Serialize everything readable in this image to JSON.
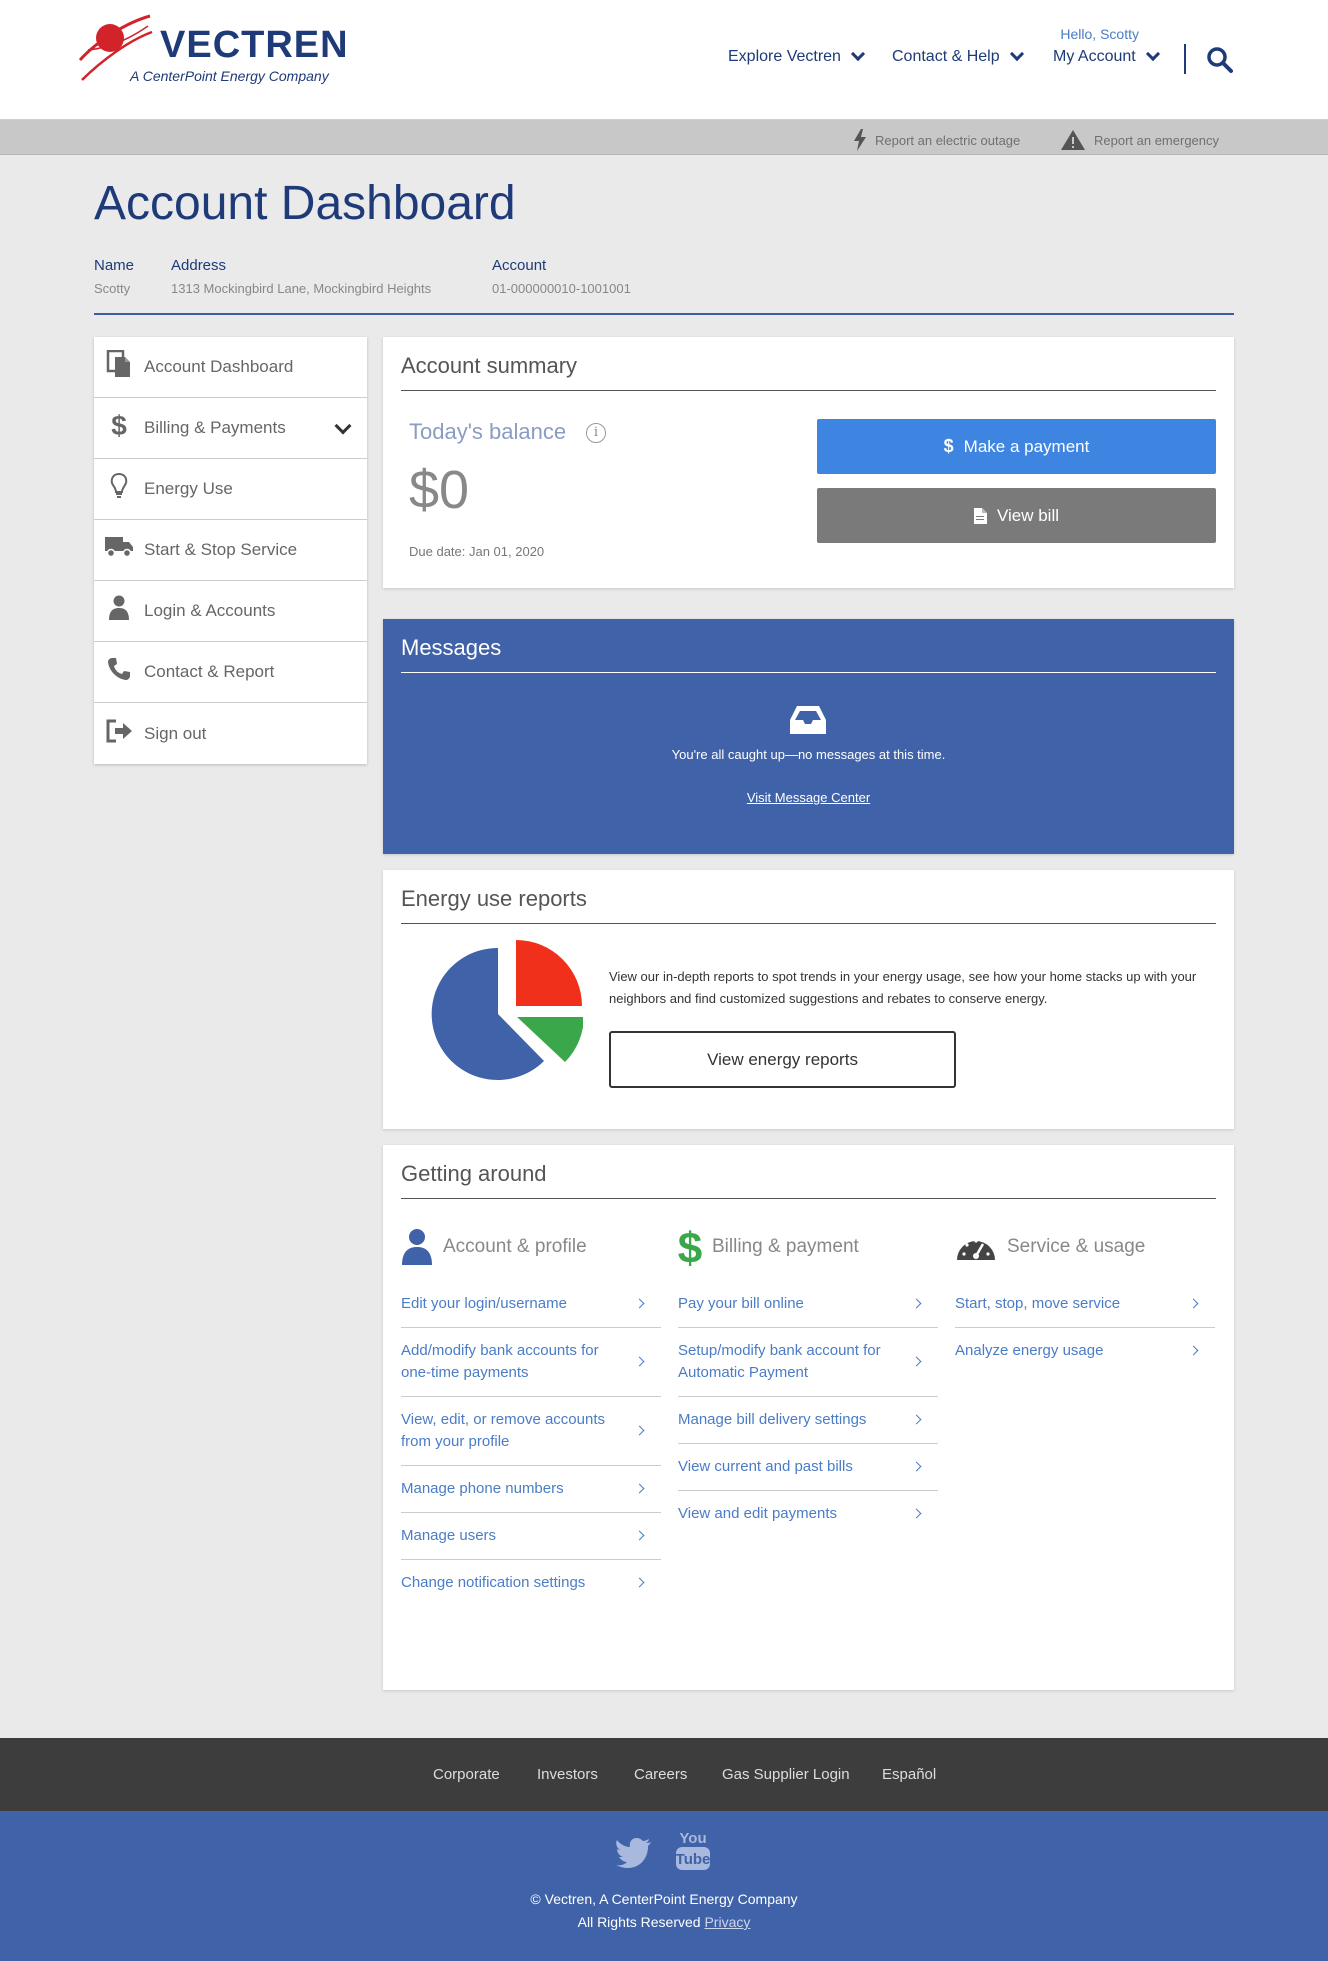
{
  "header": {
    "logo_word": "VECTREN",
    "logo_sub": "A CenterPoint Energy Company",
    "greeting": "Hello, Scotty",
    "nav": [
      "Explore Vectren",
      "Contact & Help",
      "My Account"
    ]
  },
  "utility": {
    "outage": "Report an electric outage",
    "emergency": "Report an emergency"
  },
  "page": {
    "title": "Account Dashboard",
    "name_label": "Name",
    "name_value": "Scotty",
    "address_label": "Address",
    "address_value": "1313 Mockingbird Lane, Mockingbird Heights",
    "account_label": "Account",
    "account_value": "01-000000010-1001001"
  },
  "sidebar": {
    "items": [
      {
        "label": "Account Dashboard",
        "icon": "document-icon"
      },
      {
        "label": "Billing & Payments",
        "icon": "dollar-icon"
      },
      {
        "label": "Energy Use",
        "icon": "lightbulb-icon"
      },
      {
        "label": "Start & Stop Service",
        "icon": "truck-icon"
      },
      {
        "label": "Login & Accounts",
        "icon": "user-icon"
      },
      {
        "label": "Contact & Report",
        "icon": "phone-icon"
      },
      {
        "label": "Sign out",
        "icon": "sign-out-icon"
      }
    ]
  },
  "summary": {
    "title": "Account summary",
    "balance_label": "Today's balance",
    "balance_value": "$0",
    "due_date": "Due date: Jan 01, 2020",
    "pay_button": "Make a payment",
    "view_bill_button": "View bill"
  },
  "messages": {
    "title": "Messages",
    "empty_text": "You're all caught up—no messages at this time.",
    "link": "Visit Message Center"
  },
  "energy": {
    "title": "Energy use reports",
    "description": "View our in-depth reports to spot trends in your energy usage, see how your home stacks up with your neighbors and find customized suggestions and rebates to conserve energy.",
    "button": "View energy reports"
  },
  "getting_around": {
    "title": "Getting around",
    "columns": [
      {
        "title": "Account & profile",
        "links": [
          "Edit your login/username",
          "Add/modify bank accounts for one-time payments",
          "View, edit, or remove accounts from your profile",
          "Manage phone numbers",
          "Manage users",
          "Change notification settings"
        ]
      },
      {
        "title": "Billing & payment",
        "links": [
          "Pay your bill online",
          "Setup/modify bank account for Automatic Payment",
          "Manage bill delivery settings",
          "View current and past bills",
          "View and edit payments"
        ]
      },
      {
        "title": "Service & usage",
        "links": [
          "Start, stop, move service",
          "Analyze energy usage"
        ]
      }
    ]
  },
  "footer": {
    "links": [
      "Corporate",
      "Investors",
      "Careers",
      "Gas Supplier Login",
      "Español"
    ],
    "copyright": "© Vectren, A CenterPoint Energy Company",
    "rights": "All Rights Reserved",
    "privacy": "Privacy"
  },
  "colors": {
    "brand_navy": "#1e3a78",
    "brand_blue": "#3f62a8",
    "button_blue": "#3d85e0",
    "link_blue": "#4a7cc7",
    "logo_red": "#d2232a",
    "green": "#3aa84a"
  }
}
